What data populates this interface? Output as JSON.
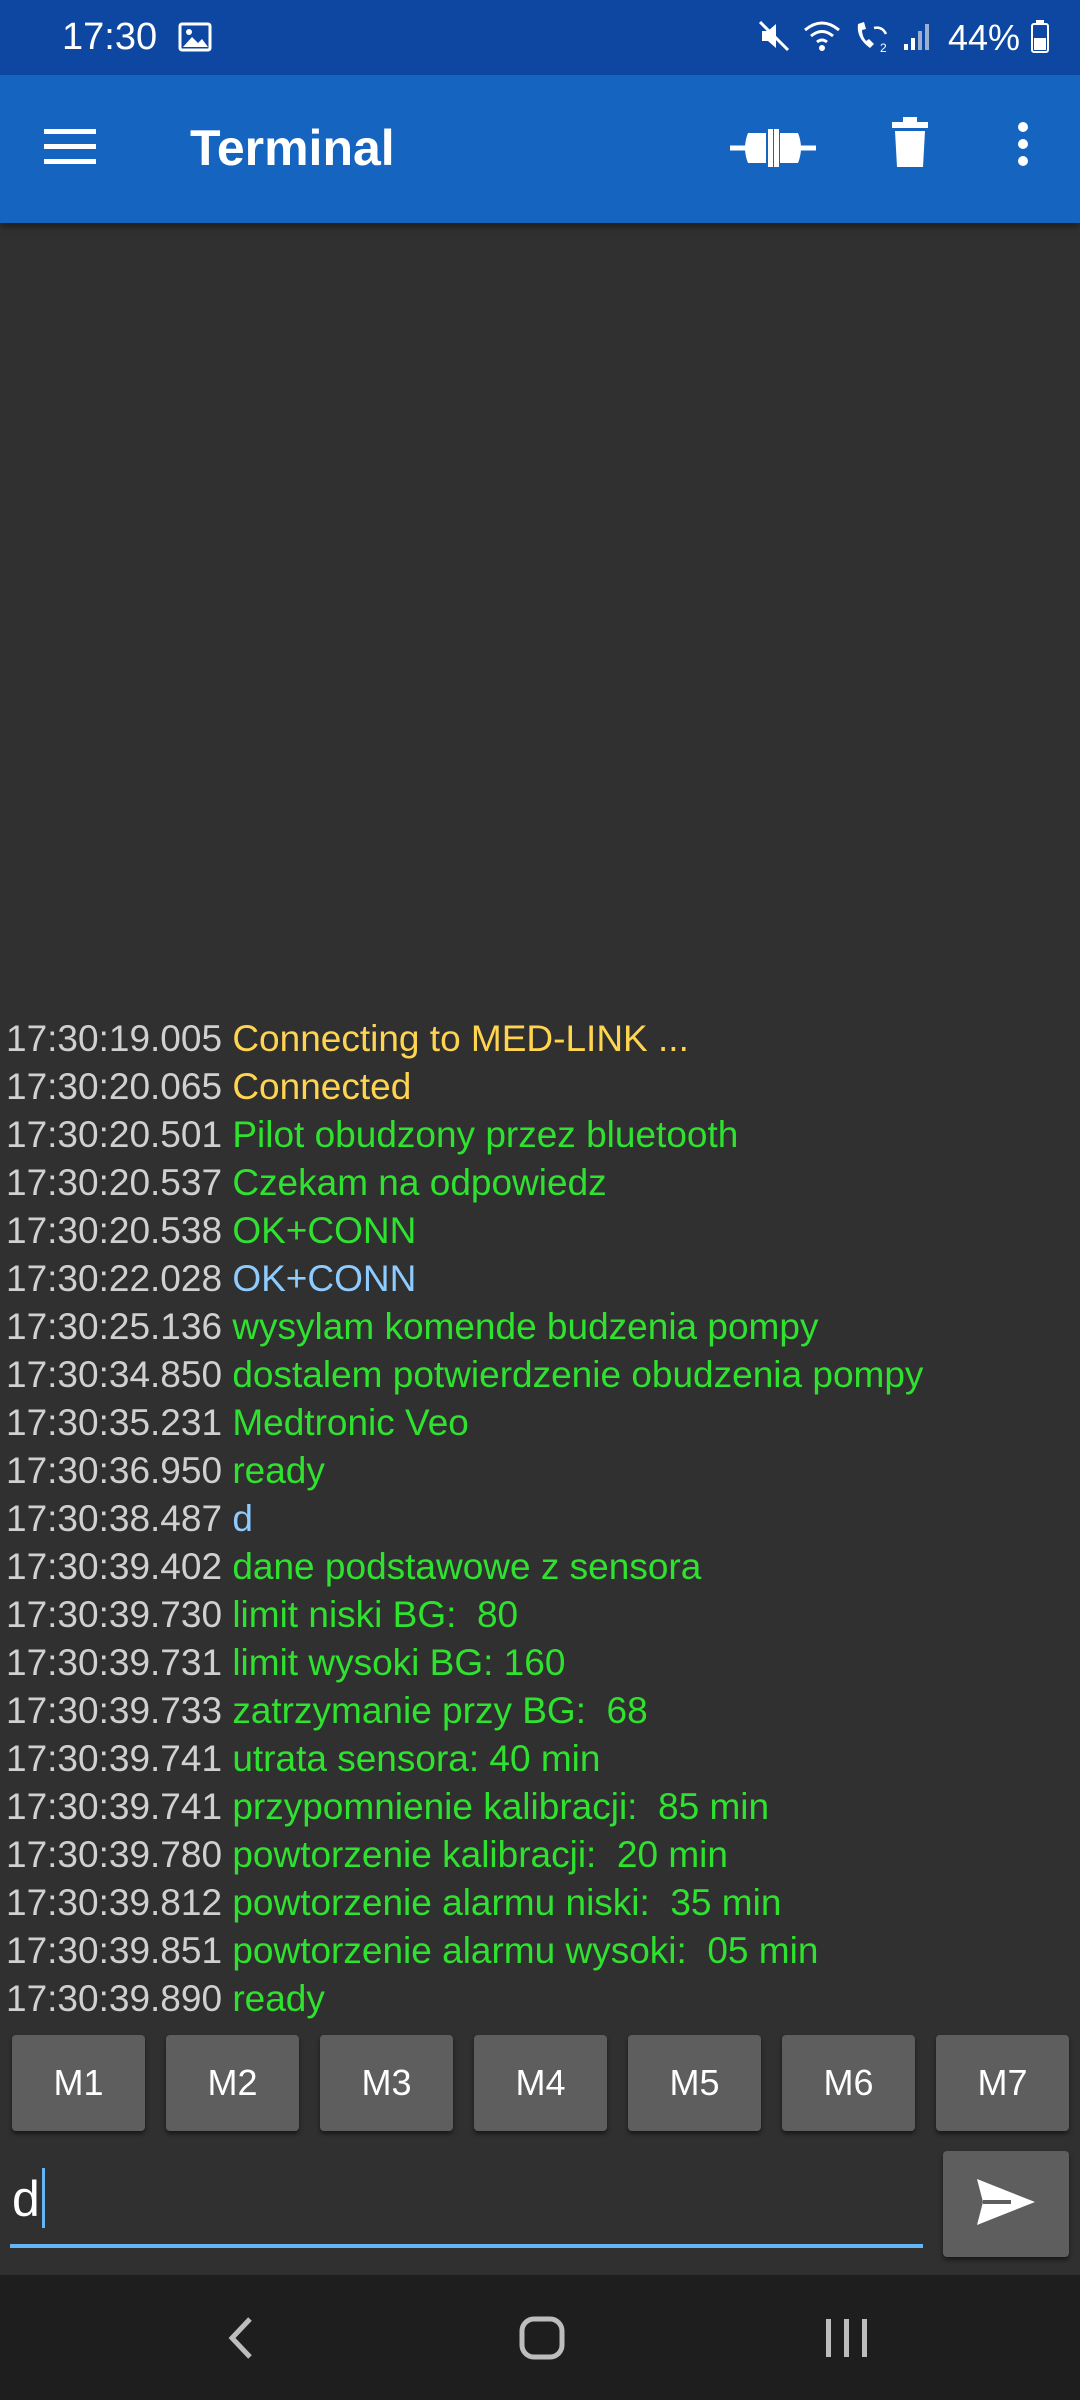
{
  "status_bar": {
    "time": "17:30",
    "battery": "44%"
  },
  "app_bar": {
    "title": "Terminal"
  },
  "log": [
    {
      "time": "17:30:19.005",
      "text": "Connecting to MED-LINK ...",
      "kind": "status"
    },
    {
      "time": "17:30:20.065",
      "text": "Connected",
      "kind": "status"
    },
    {
      "time": "17:30:20.501",
      "text": "Pilot obudzony przez bluetooth",
      "kind": "recv"
    },
    {
      "time": "17:30:20.537",
      "text": "Czekam na odpowiedz",
      "kind": "recv"
    },
    {
      "time": "17:30:20.538",
      "text": "OK+CONN",
      "kind": "recv"
    },
    {
      "time": "17:30:22.028",
      "text": "OK+CONN",
      "kind": "send"
    },
    {
      "time": "17:30:25.136",
      "text": "wysylam komende budzenia pompy",
      "kind": "recv"
    },
    {
      "time": "17:30:34.850",
      "text": "dostalem potwierdzenie obudzenia pompy",
      "kind": "recv"
    },
    {
      "time": "17:30:35.231",
      "text": "Medtronic Veo",
      "kind": "recv"
    },
    {
      "time": "17:30:36.950",
      "text": "ready",
      "kind": "recv"
    },
    {
      "time": "17:30:38.487",
      "text": "d",
      "kind": "send"
    },
    {
      "time": "17:30:39.402",
      "text": "dane podstawowe z sensora",
      "kind": "recv"
    },
    {
      "time": "17:30:39.730",
      "text": "limit niski BG:  80",
      "kind": "recv"
    },
    {
      "time": "17:30:39.731",
      "text": "limit wysoki BG: 160",
      "kind": "recv"
    },
    {
      "time": "17:30:39.733",
      "text": "zatrzymanie przy BG:  68",
      "kind": "recv"
    },
    {
      "time": "17:30:39.741",
      "text": "utrata sensora: 40 min",
      "kind": "recv"
    },
    {
      "time": "17:30:39.741",
      "text": "przypomnienie kalibracji:  85 min",
      "kind": "recv"
    },
    {
      "time": "17:30:39.780",
      "text": "powtorzenie kalibracji:  20 min",
      "kind": "recv"
    },
    {
      "time": "17:30:39.812",
      "text": "powtorzenie alarmu niski:  35 min",
      "kind": "recv"
    },
    {
      "time": "17:30:39.851",
      "text": "powtorzenie alarmu wysoki:  05 min",
      "kind": "recv"
    },
    {
      "time": "17:30:39.890",
      "text": "ready",
      "kind": "recv"
    }
  ],
  "macros": [
    "M1",
    "M2",
    "M3",
    "M4",
    "M5",
    "M6",
    "M7"
  ],
  "input": {
    "value": "d"
  },
  "icons": {
    "status": [
      "gallery-icon",
      "mute-icon",
      "wifi-icon",
      "wifi-calling-icon",
      "signal-icon",
      "battery-icon"
    ],
    "app_bar": [
      "menu-icon",
      "connect-icon",
      "trash-icon",
      "more-vert-icon"
    ],
    "input": [
      "send-icon"
    ],
    "nav": [
      "back-icon",
      "home-icon",
      "recents-icon"
    ]
  },
  "colors": {
    "app_bar": "#1565c0",
    "status_bar": "#0d47a1",
    "background": "#303030",
    "timestamp": "#d0d0d0",
    "status_text": "#ffd54f",
    "received_text": "#2fe22f",
    "sent_text": "#8ecbff",
    "input_underline": "#64b5f6"
  }
}
